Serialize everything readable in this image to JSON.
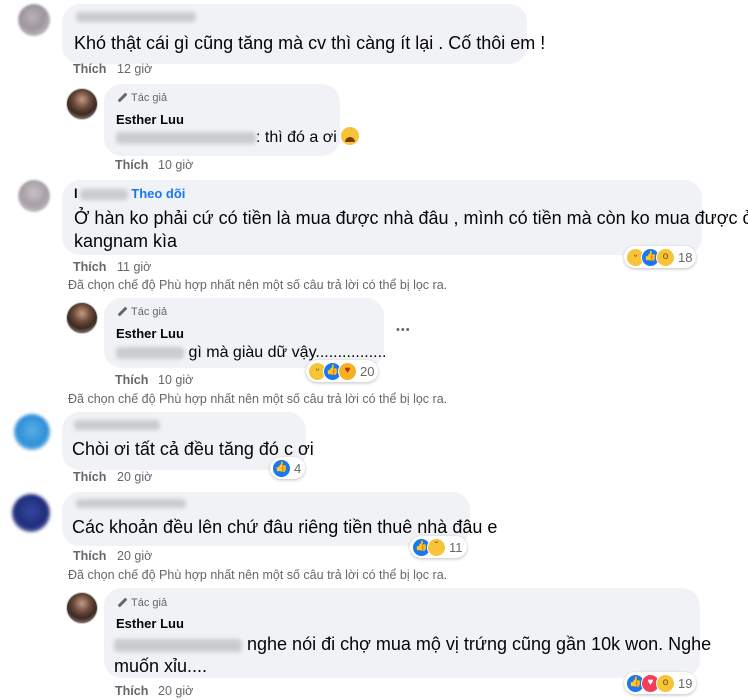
{
  "comments": [
    {
      "text": "Khó thật cái gì cũng tăng mà cv thì càng ít lại . Cố thôi em !",
      "like_label": "Thích",
      "time": "12 giờ"
    },
    {
      "author_badge": "Tác giả",
      "name": "Esther Luu",
      "text": ": thì đó a ơi",
      "like_label": "Thích",
      "time": "10 giờ"
    },
    {
      "name_prefix": "l",
      "follow_label": "Theo dõi",
      "text_line1": "Ở hàn ko phải cứ có tiền là mua được nhà đâu , mình có tiền mà còn ko mua được ở",
      "text_line2": "kangnam kìa",
      "like_label": "Thích",
      "time": "11 giờ",
      "reaction_count": "18",
      "filter_note": "Đã chọn chế độ Phù hợp nhất nên một số câu trả lời có thể bị lọc ra."
    },
    {
      "author_badge": "Tác giả",
      "name": "Esther Luu",
      "text": "gì mà giàu dữ vậy................",
      "like_label": "Thích",
      "time": "10 giờ",
      "reaction_count": "20",
      "more_label": "•••",
      "filter_note": "Đã chọn chế độ Phù hợp nhất nên một số câu trả lời có thể bị lọc ra."
    },
    {
      "text": "Chòi ơi tất cả đều tăng đó c ơi",
      "like_label": "Thích",
      "time": "20 giờ",
      "reaction_count": "4"
    },
    {
      "text": "Các khoản đều lên chứ đâu riêng tiền thuê nhà đâu e",
      "like_label": "Thích",
      "time": "20 giờ",
      "reaction_count": "11",
      "filter_note": "Đã chọn chế độ Phù hợp nhất nên một số câu trả lời có thể bị lọc ra."
    },
    {
      "author_badge": "Tác giả",
      "name": "Esther Luu",
      "text_line1": "nghe nói đi chợ mua mộ vị trứng cũng gần 10k won. Nghe",
      "text_line2": "muốn xỉu....",
      "like_label": "Thích",
      "time": "20 giờ",
      "reaction_count": "19"
    }
  ],
  "colors": {
    "bubble": "#f0f2f5",
    "link_blue": "#1877f2",
    "secondary_text": "#65676b"
  }
}
